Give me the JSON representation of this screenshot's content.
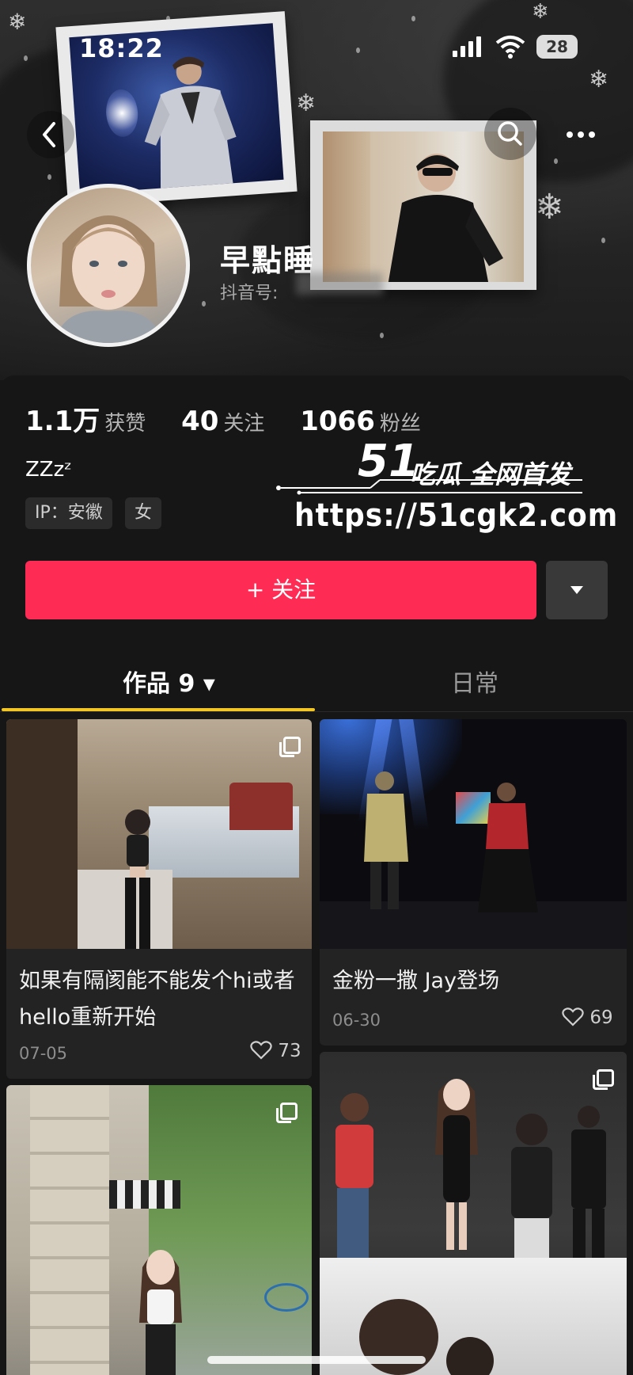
{
  "status_bar": {
    "time": "18:22",
    "battery": "28"
  },
  "profile": {
    "name": "早點睡",
    "douyin_id_label": "抖音号:",
    "stats": [
      {
        "value": "1.1万",
        "label": "获赞"
      },
      {
        "value": "40",
        "label": "关注"
      },
      {
        "value": "1066",
        "label": "粉丝"
      }
    ],
    "bio": "ZZzᶻ",
    "tags": [
      "IP：安徽",
      "女"
    ]
  },
  "watermark": {
    "logo": "51",
    "title": "吃瓜 全网首发",
    "url": "https://51cgk2.com"
  },
  "actions": {
    "follow_label": "+ 关注"
  },
  "tabs": [
    {
      "label": "作品 9 ▾",
      "active": true
    },
    {
      "label": "日常",
      "active": false
    }
  ],
  "videos": [
    {
      "title": "如果有隔阂能不能发个hi或者hello重新开始",
      "date": "07-05",
      "likes": "73",
      "multi_image": true
    },
    {
      "title": "金粉一撒 Jay登场",
      "date": "06-30",
      "likes": "69",
      "multi_image": false
    },
    {
      "title": "",
      "date": "",
      "likes": "",
      "multi_image": true
    },
    {
      "title": "",
      "date": "",
      "likes": "",
      "multi_image": true
    }
  ],
  "colors": {
    "follow": "#fe2c55",
    "tab_underline": "#f3c623",
    "background": "#161616"
  },
  "icons": [
    "back-icon",
    "search-icon",
    "more-icon",
    "dropdown-icon",
    "heart-icon",
    "signal-icon",
    "wifi-icon",
    "battery-icon"
  ]
}
